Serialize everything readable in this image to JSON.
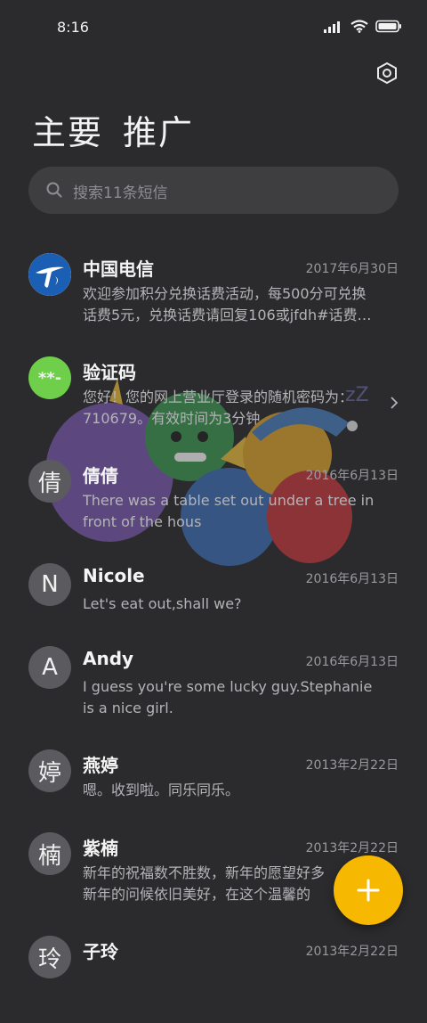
{
  "status_bar": {
    "time": "8:16"
  },
  "header": {
    "tabs": [
      {
        "label": "主要"
      },
      {
        "label": "推广"
      }
    ]
  },
  "search": {
    "placeholder": "搜索11条短信"
  },
  "messages": [
    {
      "name": "中国电信",
      "date": "2017年6月30日",
      "lines": [
        "欢迎参加积分兑换话费活动，每500分可兑换",
        "话费5元，兑换话费请回复106或jfdh#话费…"
      ],
      "avatar_icon": "china-telecom-logo"
    },
    {
      "name": "验证码",
      "date": "",
      "lines": [
        "您好！您的网上营业厅登录的随机密码为：",
        "710679。有效时间为3分钟"
      ],
      "avatar_text": "**-",
      "avatar_color": "#6fcf4a"
    },
    {
      "name": "倩倩",
      "date": "2016年6月13日",
      "lines": [
        "There was a table set out under a tree in",
        "front of the hous"
      ],
      "avatar_text": "倩"
    },
    {
      "name": "Nicole",
      "date": "2016年6月13日",
      "lines": [
        "Let's eat out,shall we?"
      ],
      "avatar_text": "N"
    },
    {
      "name": "Andy",
      "date": "2016年6月13日",
      "lines": [
        "I guess you're some lucky guy.Stephanie",
        "is a nice girl."
      ],
      "avatar_text": "A"
    },
    {
      "name": "燕婷",
      "date": "2013年2月22日",
      "lines": [
        "嗯。收到啦。同乐同乐。"
      ],
      "avatar_text": "婷"
    },
    {
      "name": "紫楠",
      "date": "2013年2月22日",
      "lines": [
        "新年的祝福数不胜数，新年的愿望好多",
        "新年的问候依旧美好，在这个温馨的"
      ],
      "avatar_text": "楠"
    },
    {
      "name": "子玲",
      "date": "2013年2月22日",
      "lines": [],
      "avatar_text": "玲"
    }
  ],
  "colors": {
    "background": "#2b2b2d",
    "fab": "#f7b801",
    "verify_avatar": "#6fcf4a"
  },
  "icons": {
    "settings": "settings-hexagon-icon",
    "search": "search-icon",
    "fab": "plus-icon",
    "chevron": "chevron-right-icon"
  }
}
